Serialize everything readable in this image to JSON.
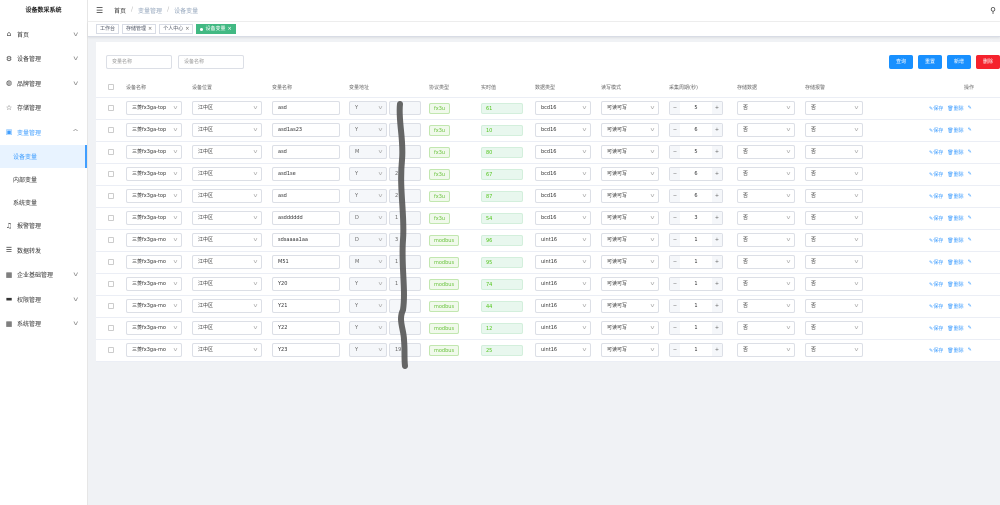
{
  "app": {
    "title": "设备数采系统"
  },
  "sidebar": {
    "items": [
      {
        "label": "首页",
        "icon": "home-icon",
        "has_chevron": true
      },
      {
        "label": "设备管理",
        "icon": "gear-icon",
        "has_chevron": true
      },
      {
        "label": "品牌管理",
        "icon": "globe-icon",
        "has_chevron": true
      },
      {
        "label": "存储管理",
        "icon": "star-icon",
        "has_chevron": false
      },
      {
        "label": "变量管理",
        "icon": "folder-icon",
        "has_chevron": true,
        "active": true,
        "children": [
          {
            "label": "设备变量",
            "active": true
          },
          {
            "label": "内部变量"
          },
          {
            "label": "系统变量"
          }
        ]
      },
      {
        "label": "报警管理",
        "icon": "bell-icon",
        "has_chevron": false
      },
      {
        "label": "数据转发",
        "icon": "database-icon",
        "has_chevron": false
      },
      {
        "label": "企业基础管理",
        "icon": "grid-icon",
        "has_chevron": true
      },
      {
        "label": "权限管理",
        "icon": "lock-icon",
        "has_chevron": true
      },
      {
        "label": "系统管理",
        "icon": "grid-icon",
        "has_chevron": true
      }
    ]
  },
  "header": {
    "breadcrumb": [
      "首页",
      "变量管理",
      "设备变量"
    ]
  },
  "tags": [
    {
      "label": "工作台",
      "active": false
    },
    {
      "label": "存储管理",
      "active": false
    },
    {
      "label": "个人中心",
      "active": false
    },
    {
      "label": "设备变量",
      "active": true
    }
  ],
  "filters": {
    "var_name_placeholder": "变量名称",
    "device_name_placeholder": "设备名称"
  },
  "toolbar": {
    "query_label": "查询",
    "reset_label": "重置",
    "add_label": "新增",
    "delete_label": "删除"
  },
  "table": {
    "columns": [
      "设备名称",
      "设备位置",
      "变量名称",
      "变量地址",
      "协议类型",
      "实时值",
      "数据类型",
      "读写模式",
      "采集周期(秒)",
      "存储数据",
      "存储报警",
      "操作"
    ],
    "op_labels": {
      "save": "保存",
      "delete": "删除"
    },
    "rows": [
      {
        "device": "三菱fx3ga-top",
        "location": "江中区",
        "name": "asd",
        "addr_type": "Y",
        "addr_num": "",
        "protocol": "fx3u",
        "value": "61",
        "datatype": "bcd16",
        "rw": "可读可写",
        "period": "5",
        "store": "否",
        "alarm": "否"
      },
      {
        "device": "三菱fx3ga-top",
        "location": "江中区",
        "name": "asd1as23",
        "addr_type": "Y",
        "addr_num": "",
        "protocol": "fx3u",
        "value": "10",
        "datatype": "bcd16",
        "rw": "可读可写",
        "period": "6",
        "store": "否",
        "alarm": "否"
      },
      {
        "device": "三菱fx3ga-top",
        "location": "江中区",
        "name": "asd",
        "addr_type": "M",
        "addr_num": "",
        "protocol": "fx3u",
        "value": "80",
        "datatype": "bcd16",
        "rw": "可读可写",
        "period": "5",
        "store": "否",
        "alarm": "否"
      },
      {
        "device": "三菱fx3ga-top",
        "location": "江中区",
        "name": "asd1se",
        "addr_type": "Y",
        "addr_num": "2",
        "protocol": "fx3u",
        "value": "67",
        "datatype": "bcd16",
        "rw": "可读可写",
        "period": "6",
        "store": "否",
        "alarm": "否"
      },
      {
        "device": "三菱fx3ga-top",
        "location": "江中区",
        "name": "asd",
        "addr_type": "Y",
        "addr_num": "2",
        "protocol": "fx3u",
        "value": "87",
        "datatype": "bcd16",
        "rw": "可读可写",
        "period": "6",
        "store": "否",
        "alarm": "否"
      },
      {
        "device": "三菱fx3ga-top",
        "location": "江中区",
        "name": "asdddddd",
        "addr_type": "D",
        "addr_num": "1",
        "protocol": "fx3u",
        "value": "54",
        "datatype": "bcd16",
        "rw": "可读可写",
        "period": "3",
        "store": "否",
        "alarm": "否"
      },
      {
        "device": "三菱fx3ga-mo",
        "location": "江中区",
        "name": "sdsaaaa1aa",
        "addr_type": "D",
        "addr_num": "3",
        "protocol": "modbus",
        "value": "96",
        "datatype": "uint16",
        "rw": "可读可写",
        "period": "1",
        "store": "否",
        "alarm": "否"
      },
      {
        "device": "三菱fx3ga-mo",
        "location": "江中区",
        "name": "M51",
        "addr_type": "M",
        "addr_num": "1",
        "protocol": "modbus",
        "value": "95",
        "datatype": "uint16",
        "rw": "可读可写",
        "period": "1",
        "store": "否",
        "alarm": "否"
      },
      {
        "device": "三菱fx3ga-mo",
        "location": "江中区",
        "name": "Y20",
        "addr_type": "Y",
        "addr_num": "1",
        "protocol": "modbus",
        "value": "74",
        "datatype": "uint16",
        "rw": "可读可写",
        "period": "1",
        "store": "否",
        "alarm": "否"
      },
      {
        "device": "三菱fx3ga-mo",
        "location": "江中区",
        "name": "Y21",
        "addr_type": "Y",
        "addr_num": "",
        "protocol": "modbus",
        "value": "44",
        "datatype": "uint16",
        "rw": "可读可写",
        "period": "1",
        "store": "否",
        "alarm": "否"
      },
      {
        "device": "三菱fx3ga-mo",
        "location": "江中区",
        "name": "Y22",
        "addr_type": "Y",
        "addr_num": "",
        "protocol": "modbus",
        "value": "12",
        "datatype": "uint16",
        "rw": "可读可写",
        "period": "1",
        "store": "否",
        "alarm": "否"
      },
      {
        "device": "三菱fx3ga-mo",
        "location": "江中区",
        "name": "Y23",
        "addr_type": "Y",
        "addr_num": "19",
        "protocol": "modbus",
        "value": "25",
        "datatype": "uint16",
        "rw": "可读可写",
        "period": "1",
        "store": "否",
        "alarm": "否"
      }
    ]
  },
  "colors": {
    "accent": "#409eff",
    "tag_active": "#42b983",
    "delete": "#f5222d"
  }
}
